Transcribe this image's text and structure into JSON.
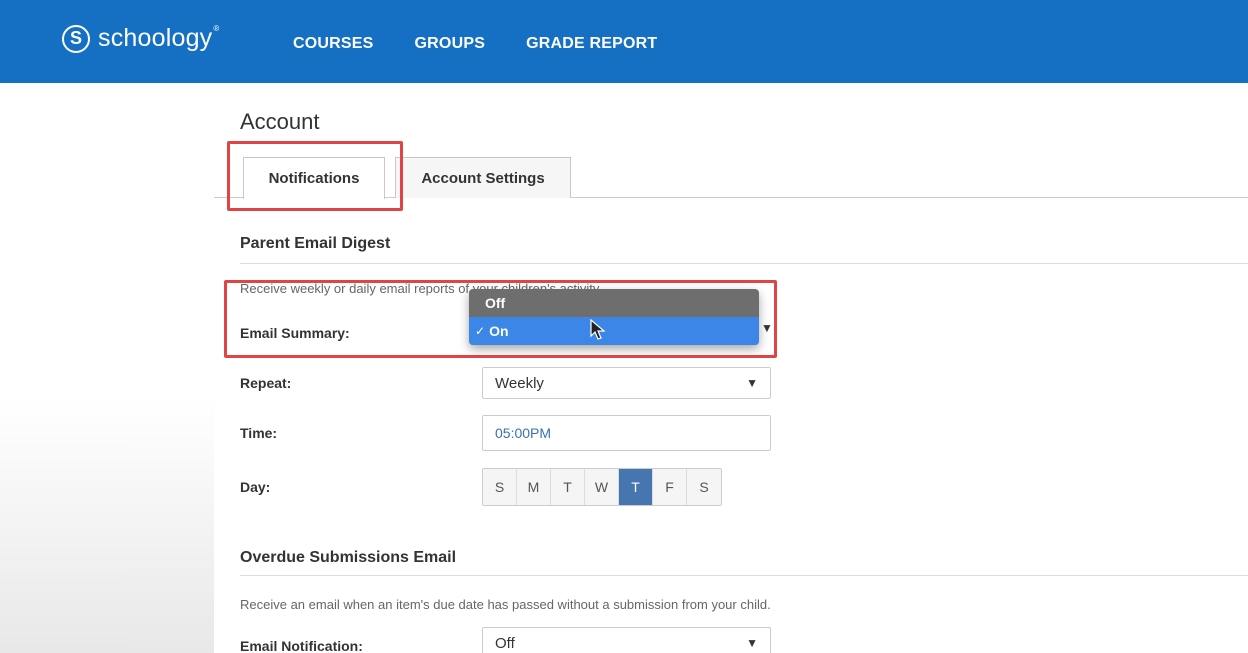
{
  "header": {
    "logo_mark": "S",
    "logo_text": "schoology",
    "nav": [
      "COURSES",
      "GROUPS",
      "GRADE REPORT"
    ]
  },
  "page": {
    "title": "Account",
    "tabs": [
      "Notifications",
      "Account Settings"
    ]
  },
  "digest": {
    "title": "Parent Email Digest",
    "description": "Receive weekly or daily email reports of your children's activity.",
    "email_summary_label": "Email Summary:",
    "email_summary_options": [
      "Off",
      "On"
    ],
    "email_summary_value": "On",
    "repeat_label": "Repeat:",
    "repeat_value": "Weekly",
    "time_label": "Time:",
    "time_value": "05:00PM",
    "day_label": "Day:",
    "days": [
      "S",
      "M",
      "T",
      "W",
      "T",
      "F",
      "S"
    ],
    "selected_day_index": 4
  },
  "overdue": {
    "title": "Overdue Submissions Email",
    "description": "Receive an email when an item's due date has passed without a submission from your child.",
    "email_notification_label": "Email Notification:",
    "email_notification_value": "Off"
  },
  "colors": {
    "header_blue": "#1570c4",
    "highlight_red": "#e04545",
    "dropdown_selected": "#3b86e6",
    "day_active": "#4576b0"
  }
}
